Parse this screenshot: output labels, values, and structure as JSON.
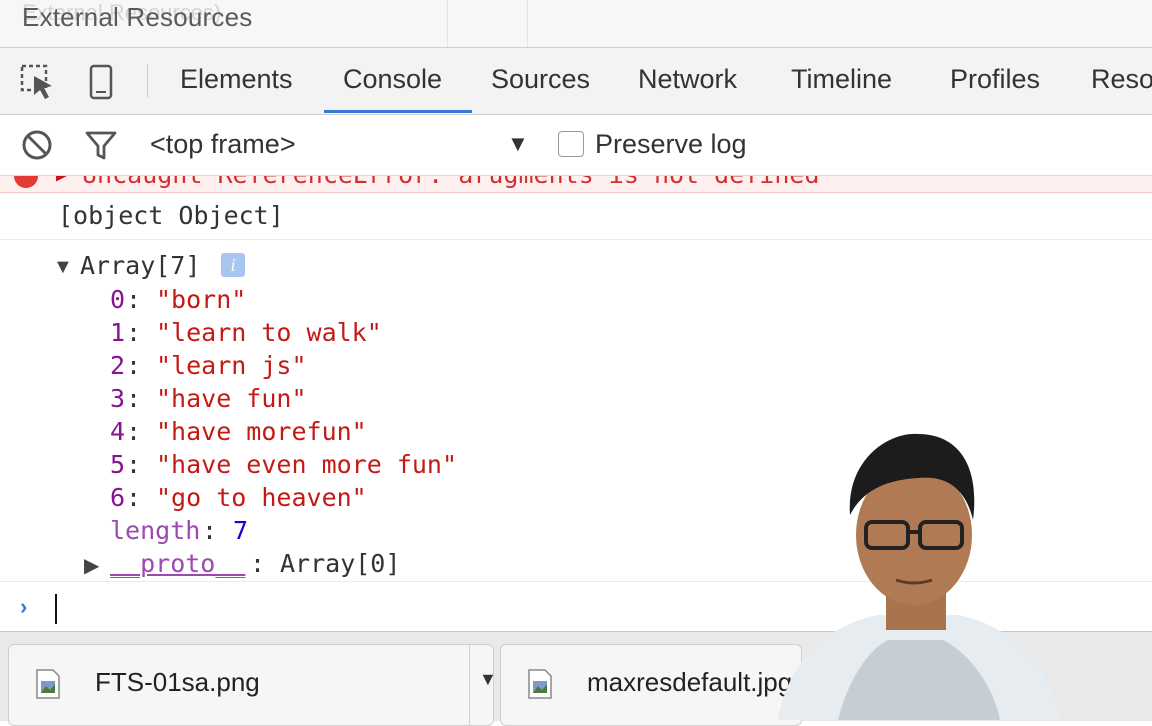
{
  "window": {
    "title": "External Resources",
    "ghost_title": "External Resources)"
  },
  "tabs": [
    {
      "label": "Elements"
    },
    {
      "label": "Console",
      "active": true
    },
    {
      "label": "Sources"
    },
    {
      "label": "Network"
    },
    {
      "label": "Timeline"
    },
    {
      "label": "Profiles"
    },
    {
      "label": "Reso"
    }
  ],
  "toolbar": {
    "context": "<top frame>",
    "context_arrow": "▼",
    "preserve_log_label": "Preserve log",
    "preserve_log_checked": false
  },
  "console": {
    "error_text": "Uncaught ReferenceError: arugments is not defined",
    "object_line": "[object Object]",
    "array_label": "Array[7]",
    "array_info": "i",
    "entries": [
      {
        "index": "0",
        "value": "\"born\""
      },
      {
        "index": "1",
        "value": "\"learn to walk\""
      },
      {
        "index": "2",
        "value": "\"learn js\""
      },
      {
        "index": "3",
        "value": "\"have fun\""
      },
      {
        "index": "4",
        "value": "\"have morefun\""
      },
      {
        "index": "5",
        "value": "\"have even more fun\""
      },
      {
        "index": "6",
        "value": "\"go to heaven\""
      }
    ],
    "length_key": "length",
    "length_value": "7",
    "proto_key": "__proto__",
    "proto_value": "Array[0]",
    "prompt": "›"
  },
  "downloads": [
    {
      "name": "FTS-01sa.png"
    },
    {
      "name": "maxresdefault.jpg"
    }
  ],
  "colors": {
    "accent": "#3879d9",
    "string": "#c41a16",
    "key": "#881391",
    "number": "#1c00cf",
    "error": "#d32f2f"
  }
}
